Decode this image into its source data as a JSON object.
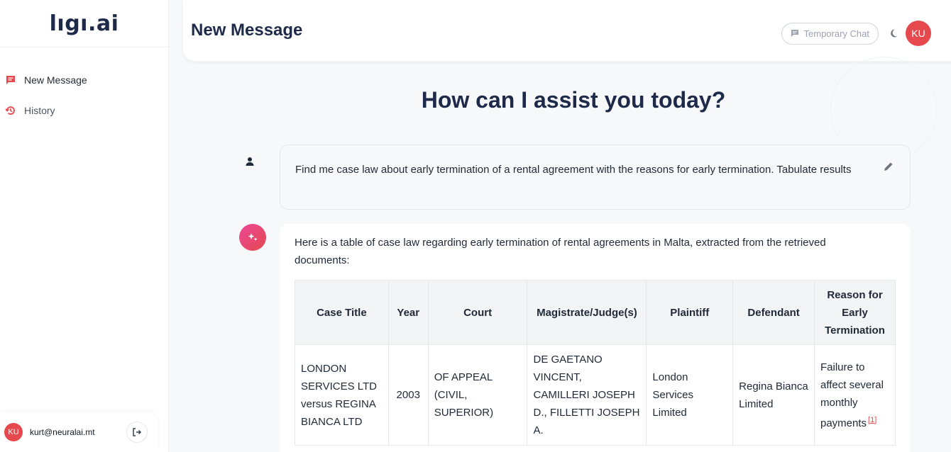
{
  "app": {
    "logo": "lıgı.ai"
  },
  "sidebar": {
    "items": [
      {
        "label": "New Message",
        "icon": "chat-icon",
        "active": true
      },
      {
        "label": "History",
        "icon": "history-icon",
        "active": false
      }
    ],
    "user": {
      "initials": "KU",
      "email": "kurt@neuralai.mt"
    }
  },
  "header": {
    "title": "New Message",
    "temporary_chat_label": "Temporary Chat",
    "avatar_initials": "KU"
  },
  "main": {
    "greeting": "How can I assist you today?",
    "user_message": "Find me case law about early termination of a rental agreement with the reasons for early termination. Tabulate results",
    "ai_intro": "Here is a table of case law regarding early termination of rental agreements in Malta, extracted from the retrieved documents:",
    "table": {
      "headers": [
        "Case Title",
        "Year",
        "Court",
        "Magistrate/Judge(s)",
        "Plaintiff",
        "Defendant",
        "Reason for Early Termination"
      ],
      "rows": [
        {
          "case_title": "LONDON SERVICES LTD versus REGINA BIANCA LTD",
          "year": "2003",
          "court": "OF APPEAL (CIVIL, SUPERIOR)",
          "judges": "DE GAETANO VINCENT, CAMILLERI JOSEPH D., FILLETTI JOSEPH A.",
          "plaintiff": "London Services Limited",
          "defendant": "Regina Bianca Limited",
          "reason": "Failure to affect several monthly payments",
          "citation": "[1]"
        }
      ]
    }
  },
  "colors": {
    "accent": "#e5484d",
    "title": "#1e2a4a"
  }
}
